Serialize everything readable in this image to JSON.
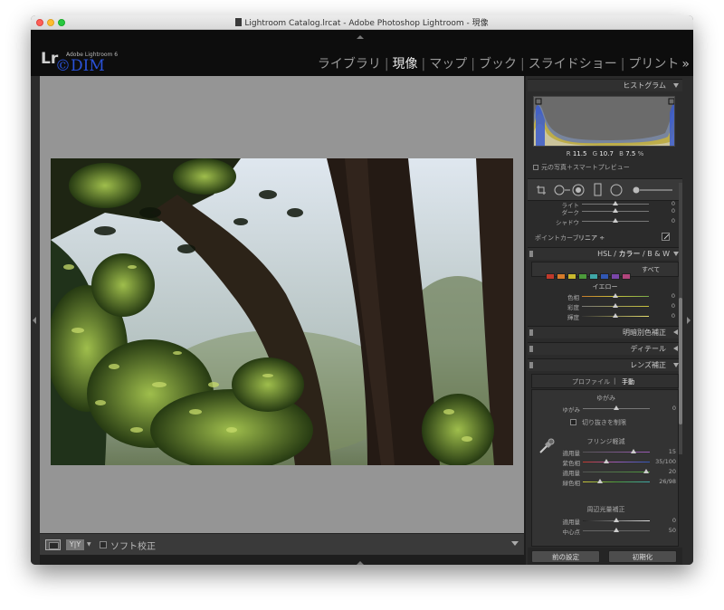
{
  "window": {
    "title": "Lightroom Catalog.lrcat - Adobe Photoshop Lightroom - 現像"
  },
  "logo": {
    "lr": "Lr",
    "sub": "Adobe Lightroom 6",
    "watermark": "©DIM"
  },
  "modules": [
    "ライブラリ",
    "現像",
    "マップ",
    "ブック",
    "スライドショー",
    "プリント"
  ],
  "active_module": "現像",
  "more_modules": "»",
  "toolbar": {
    "yy_label": "Y|Y",
    "soft_proof_label": "ソフト校正"
  },
  "histogram": {
    "header": "ヒストグラム",
    "r_label": "R",
    "r_value": "11.5",
    "g_label": "G",
    "g_value": "10.7",
    "b_label": "B",
    "b_value": "7.5",
    "pct": "%",
    "original_label": "元の写真＋スマートプレビュー"
  },
  "tone_curve": {
    "rows": [
      {
        "label": "ライト",
        "value": "0",
        "pos": 0.5
      },
      {
        "label": "ダーク",
        "value": "0",
        "pos": 0.5
      },
      {
        "label": "シャドウ",
        "value": "0",
        "pos": 0.5
      }
    ],
    "point_curve_label": "ポイントカーブ",
    "point_curve_value": "リニア ÷"
  },
  "hsl": {
    "header": "HSL / カラー / B & W",
    "hsl_label": "HSL",
    "color_label": "カラー",
    "bw_label": "B & W",
    "swatches": [
      "#c0392b",
      "#d67b2a",
      "#c8b82e",
      "#4c9a3b",
      "#3fa7a7",
      "#3157b3",
      "#7a46a8",
      "#b1457c"
    ],
    "all_label": "すべて",
    "selected_color": "イエロー",
    "rows": [
      {
        "label": "色相",
        "value": "0",
        "pos": 0.5
      },
      {
        "label": "彩度",
        "value": "0",
        "pos": 0.5
      },
      {
        "label": "輝度",
        "value": "0",
        "pos": 0.5
      }
    ]
  },
  "panels": {
    "split_tone": "明暗別色補正",
    "detail": "ディテール",
    "lens": "レンズ補正"
  },
  "lens": {
    "tab_profile": "プロファイル",
    "tab_manual": "手動",
    "distortion_title": "ゆがみ",
    "distortion_label": "ゆがみ",
    "distortion_value": "0",
    "distortion_pos": 0.5,
    "constrain_label": "切り抜きを制限",
    "defringe_title": "フリンジ軽減",
    "defringe_rows": [
      {
        "label": "適用量",
        "value": "15",
        "pos": 0.75
      },
      {
        "label": "紫色相",
        "value": "35/100",
        "pos": 0.35
      },
      {
        "label": "適用量",
        "value": "20",
        "pos": 0.94
      },
      {
        "label": "緑色相",
        "value": "26/98",
        "pos": 0.26
      }
    ],
    "vignette_title": "周辺光量補正",
    "vignette_rows": [
      {
        "label": "適用量",
        "value": "0",
        "pos": 0.5
      },
      {
        "label": "中心点",
        "value": "50",
        "pos": 0.5
      }
    ]
  },
  "buttons": {
    "previous": "前の設定",
    "reset": "初期化"
  }
}
